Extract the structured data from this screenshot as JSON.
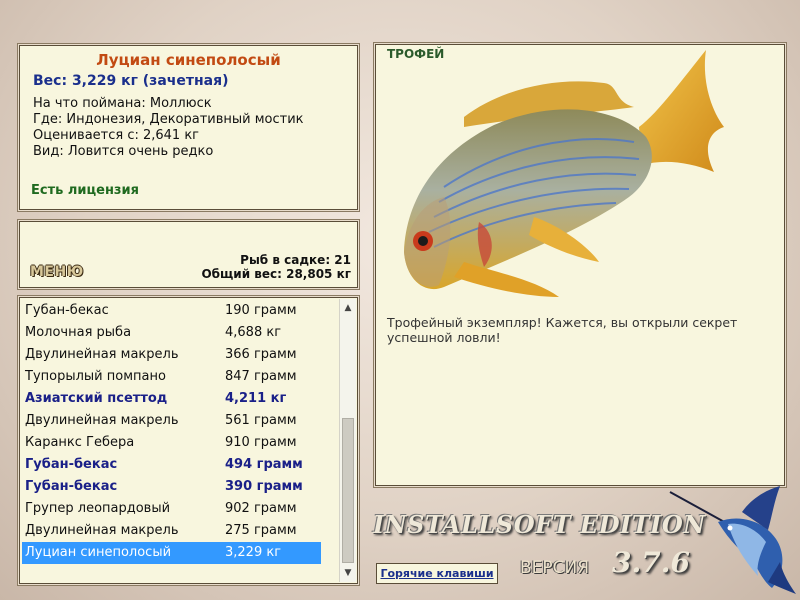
{
  "info": {
    "title": "Луциан синеполосый",
    "weight": "Вес: 3,229 кг (зачетная)",
    "lines": [
      "На что поймана: Моллюск",
      "Где: Индонезия, Декоративный мостик",
      "Оценивается с: 2,641 кг",
      "Вид: Ловится очень редко"
    ],
    "license": "Есть лицензия"
  },
  "summary": {
    "menu_label": "МЕНЮ",
    "fish_count": "Рыб в садке: 21",
    "total_weight": "Общий вес: 28,805 кг"
  },
  "catch_list": [
    {
      "name": "Губан-бекас",
      "weight": "190 грамм",
      "style": "normal"
    },
    {
      "name": "Молочная рыба",
      "weight": "4,688 кг",
      "style": "normal"
    },
    {
      "name": "Двулинейная макрель",
      "weight": "366 грамм",
      "style": "normal"
    },
    {
      "name": "Тупорылый помпано",
      "weight": "847 грамм",
      "style": "normal"
    },
    {
      "name": "Азиатский псеттод",
      "weight": "4,211 кг",
      "style": "highlight"
    },
    {
      "name": "Двулинейная макрель",
      "weight": "561 грамм",
      "style": "normal"
    },
    {
      "name": "Каранкс Гебера",
      "weight": "910 грамм",
      "style": "normal"
    },
    {
      "name": "Губан-бекас",
      "weight": "494 грамм",
      "style": "highlight"
    },
    {
      "name": "Губан-бекас",
      "weight": "390 грамм",
      "style": "highlight"
    },
    {
      "name": "Групер леопардовый",
      "weight": "902 грамм",
      "style": "normal"
    },
    {
      "name": "Двулинейная макрель",
      "weight": "275 грамм",
      "style": "normal"
    },
    {
      "name": "Луциан синеполосый",
      "weight": "3,229 кг",
      "style": "selected"
    }
  ],
  "trophy": {
    "label": "ТРОФЕЙ",
    "message": "Трофейный экземпляр! Кажется, вы открыли секрет успешной ловли!"
  },
  "footer": {
    "brand": "INSTALLSOFT EDITION",
    "version_label": "ВЕРСИЯ",
    "version_number": "3.7.6",
    "hotkeys_label": "Горячие клавиши"
  },
  "icons": {
    "fish_image": "bluestripe-snapper-image",
    "logo": "marlin-logo"
  },
  "colors": {
    "title": "#c24a12",
    "weight": "#1a2f8c",
    "license": "#1f6a1f",
    "panel_bg": "#f8f6de",
    "selection": "#3399ff",
    "highlight": "#1a2088"
  }
}
